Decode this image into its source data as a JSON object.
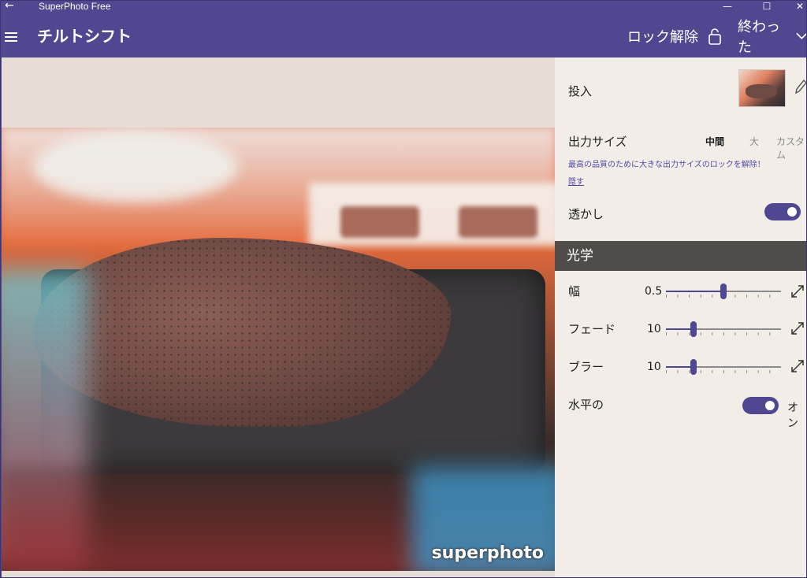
{
  "window": {
    "app_title": "SuperPhoto Free",
    "back_glyph": "←",
    "minimize_glyph": "—",
    "maximize_glyph": "☐",
    "close_glyph": "✕"
  },
  "header": {
    "title": "チルトシフト",
    "unlock_label": "ロック解除",
    "done_label": "終わった"
  },
  "canvas": {
    "watermark": "superphoto"
  },
  "panel": {
    "input_label": "投入",
    "output_size_label": "出力サイズ",
    "size_options": [
      "中間",
      "大",
      "カスタム"
    ],
    "size_selected": "中間",
    "promo_text": "最高の品質のために大きな出力サイズのロックを解除！",
    "hide_link": "隠す",
    "watermark_label": "透かし",
    "watermark_on": true,
    "section_title": "光学",
    "sliders": [
      {
        "label": "幅",
        "value": "0.5",
        "fraction": 0.5
      },
      {
        "label": "フェード",
        "value": "10",
        "fraction": 0.24
      },
      {
        "label": "ブラー",
        "value": "10",
        "fraction": 0.24
      }
    ],
    "horizontal_label": "水平の",
    "horizontal_on": true,
    "horizontal_state": "オン"
  },
  "colors": {
    "accent": "#4f4890",
    "panel_bg": "#f3ede7",
    "section_bg": "#4f4c4a",
    "canvas_bg": "#e6ddd6"
  }
}
